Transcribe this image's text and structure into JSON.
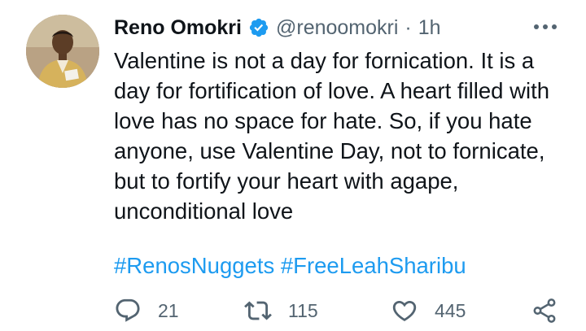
{
  "tweet": {
    "author": {
      "name": "Reno Omokri",
      "handle": "@renoomokri",
      "verified_icon": "verified-badge-icon",
      "avatar_icon": "profile-photo"
    },
    "separator": "·",
    "time": "1h",
    "more_icon": "more-options-icon",
    "text": "Valentine is not a day for fornication. It is a day for fortification of love. A heart filled with love has no space for hate. So, if you hate anyone, use Valentine Day, not to fornicate, but to fortify your heart with agape, unconditional love",
    "hashtags": [
      "#RenosNuggets",
      "#FreeLeahSharibu"
    ],
    "actions": {
      "reply_icon": "reply-icon",
      "reply_count": "21",
      "retweet_icon": "retweet-icon",
      "retweet_count": "115",
      "like_icon": "heart-icon",
      "like_count": "445",
      "share_icon": "share-icon"
    },
    "colors": {
      "link": "#1d9bf0",
      "muted": "#536471",
      "text": "#0f1419"
    }
  }
}
